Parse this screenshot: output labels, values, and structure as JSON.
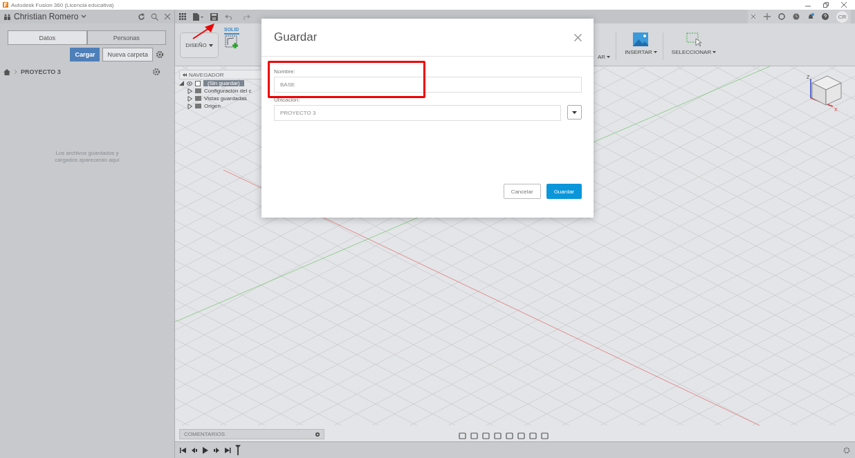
{
  "window": {
    "title": "Autodesk Fusion 360 (Licencia educativa)"
  },
  "data_panel": {
    "user": "Christian Romero",
    "tabs": [
      {
        "label": "Datos",
        "selected": true
      },
      {
        "label": "Personas",
        "selected": false
      }
    ],
    "buttons": [
      {
        "label": "Cargar",
        "kind": "primary"
      },
      {
        "label": "Nueva carpeta",
        "kind": "secondary"
      }
    ],
    "breadcrumb": "PROYECTO 3",
    "empty_message": "Los archivos guardados y cargados aparecerán aquí"
  },
  "toolbar": {
    "avatar": "CR"
  },
  "ribbon": {
    "workspace": "DISEÑO",
    "tab": "SOLID",
    "groups": [
      {
        "label": "AR"
      },
      {
        "label": "INSERTAR"
      },
      {
        "label": "SELECCIONAR"
      }
    ]
  },
  "browser": {
    "title": "NAVEGADOR",
    "items": [
      {
        "label": "(Sin guardar)",
        "expanded": true,
        "selected": true,
        "children": [
          {
            "label": "Configuración del c",
            "expanded": false,
            "selected": false
          },
          {
            "label": "Vistas guardadas",
            "expanded": false,
            "selected": false
          },
          {
            "label": "Origen",
            "expanded": false,
            "selected": false
          }
        ]
      }
    ]
  },
  "viewcube": {
    "axes": [
      "Z",
      "X"
    ]
  },
  "comments": {
    "label": "COMENTARIOS"
  },
  "dialog": {
    "title": "Guardar",
    "fields": [
      {
        "label": "Nombre:",
        "value": "BASE",
        "kind": "text"
      },
      {
        "label": "Ubicación:",
        "value": "PROYECTO 3",
        "kind": "dropdown"
      }
    ],
    "buttons": [
      {
        "label": "Cancelar",
        "kind": "secondary"
      },
      {
        "label": "Guardar",
        "kind": "primary"
      }
    ]
  }
}
